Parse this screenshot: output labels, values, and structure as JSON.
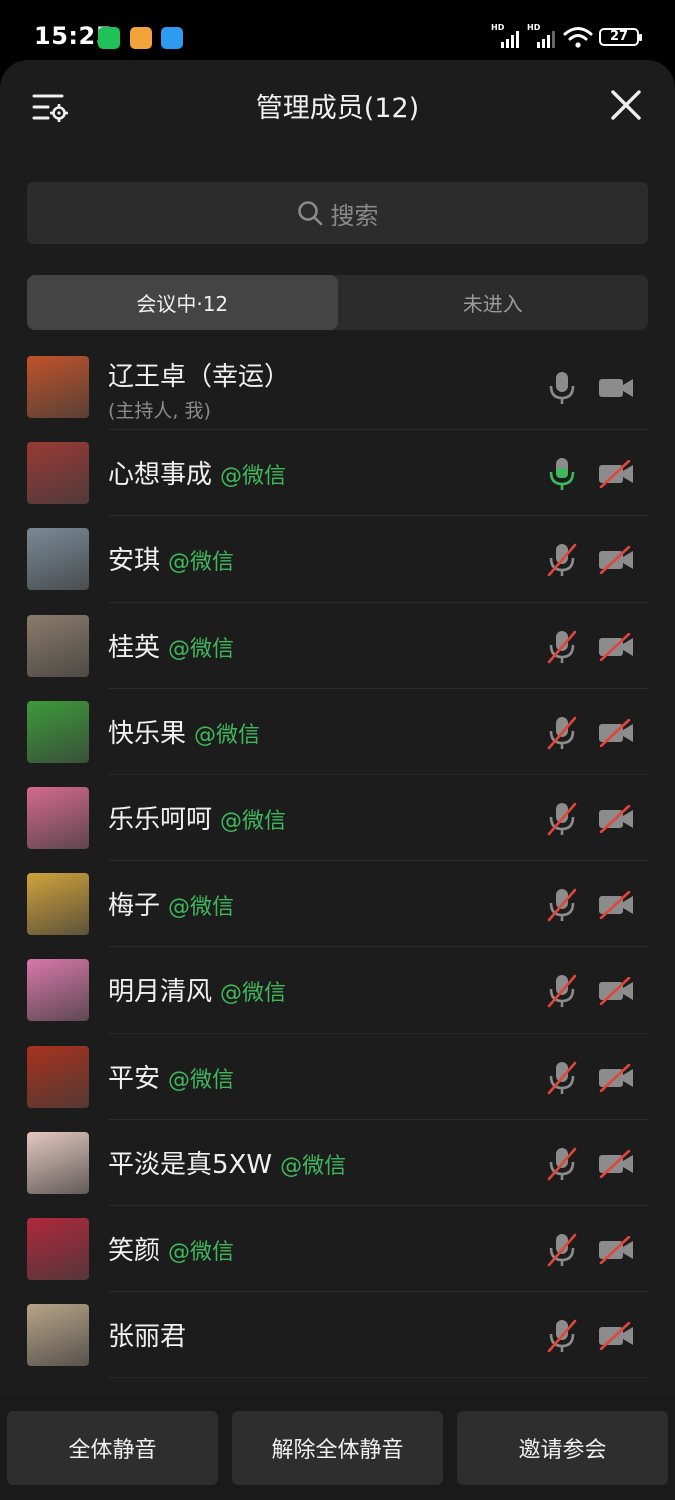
{
  "status_bar": {
    "time": "15:25",
    "battery": "27",
    "signal_label": "HD",
    "apps": [
      "wechat-icon",
      "notes-icon",
      "cloud-icon"
    ]
  },
  "header": {
    "title": "管理成员(12)"
  },
  "search": {
    "placeholder": "搜索"
  },
  "tabs": [
    {
      "label": "会议中·12",
      "active": true
    },
    {
      "label": "未进入",
      "active": false
    }
  ],
  "colors": {
    "accent_green": "#3fb85c",
    "muted_red": "#e0463c",
    "sheet_bg": "#1c1c1c"
  },
  "members": [
    {
      "name": "辽王卓（幸运）",
      "tag": "",
      "role": "(主持人, 我)",
      "mic": "on-idle",
      "camera": "on",
      "avatar_color": "#c0532a"
    },
    {
      "name": "心想事成",
      "tag": "@微信",
      "role": "",
      "mic": "on-active",
      "camera": "off",
      "avatar_color": "#9a3a36"
    },
    {
      "name": "安琪",
      "tag": "@微信",
      "role": "",
      "mic": "off",
      "camera": "off",
      "avatar_color": "#7a8a96"
    },
    {
      "name": "桂英",
      "tag": "@微信",
      "role": "",
      "mic": "off",
      "camera": "off",
      "avatar_color": "#8a7c6a"
    },
    {
      "name": "快乐果",
      "tag": "@微信",
      "role": "",
      "mic": "off",
      "camera": "off",
      "avatar_color": "#3c9a3a"
    },
    {
      "name": "乐乐呵呵",
      "tag": "@微信",
      "role": "",
      "mic": "off",
      "camera": "off",
      "avatar_color": "#d46a8e"
    },
    {
      "name": "梅子",
      "tag": "@微信",
      "role": "",
      "mic": "off",
      "camera": "off",
      "avatar_color": "#d0a23a"
    },
    {
      "name": "明月清风",
      "tag": "@微信",
      "role": "",
      "mic": "off",
      "camera": "off",
      "avatar_color": "#d778a8"
    },
    {
      "name": "平安",
      "tag": "@微信",
      "role": "",
      "mic": "off",
      "camera": "off",
      "avatar_color": "#a8321e"
    },
    {
      "name": "平淡是真5XW",
      "tag": "@微信",
      "role": "",
      "mic": "off",
      "camera": "off",
      "avatar_color": "#e4c8c0"
    },
    {
      "name": "笑颜",
      "tag": "@微信",
      "role": "",
      "mic": "off",
      "camera": "off",
      "avatar_color": "#b0283a"
    },
    {
      "name": "张丽君",
      "tag": "",
      "role": "",
      "mic": "off",
      "camera": "off",
      "avatar_color": "#b8a488"
    }
  ],
  "actions": {
    "mute_all": "全体静音",
    "unmute_all": "解除全体静音",
    "invite": "邀请参会"
  }
}
